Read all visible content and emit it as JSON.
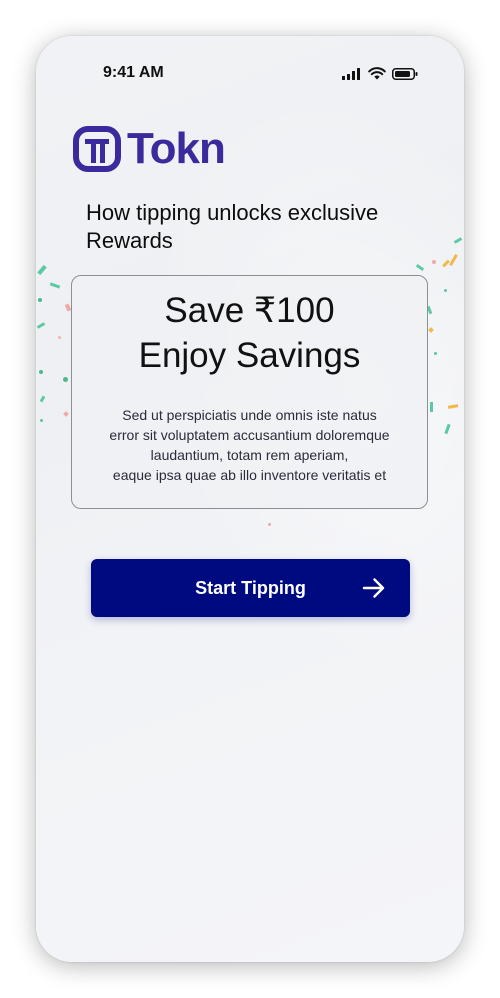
{
  "status_bar": {
    "time": "9:41 AM",
    "icons": [
      "signal-icon",
      "wifi-icon",
      "battery-icon"
    ]
  },
  "brand": {
    "name": "Tokn",
    "logo_icon": "tokn-logo-icon",
    "color": "#3b2a9e"
  },
  "headline": {
    "line1": "How tipping unlocks exclusive",
    "line2": "Rewards"
  },
  "offer": {
    "line1": "Save ₹100",
    "line2": "Enjoy Savings",
    "description": [
      "Sed ut perspiciatis unde omnis iste natus",
      "error sit voluptatem accusantium doloremque",
      "laudantium, totam rem aperiam,",
      "eaque ipsa quae ab illo inventore veritatis et"
    ]
  },
  "cta": {
    "label": "Start Tipping",
    "icon": "arrow-right-icon",
    "color": "#000a80"
  }
}
